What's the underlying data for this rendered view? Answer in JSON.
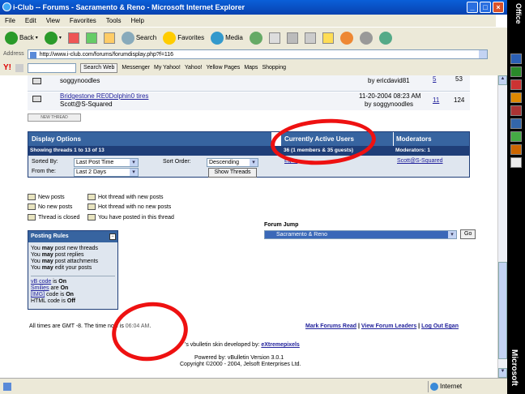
{
  "window": {
    "title": "i-Club -- Forums - Sacramento & Reno - Microsoft Internet Explorer"
  },
  "menu": [
    "File",
    "Edit",
    "View",
    "Favorites",
    "Tools",
    "Help"
  ],
  "toolbar": {
    "back": "Back",
    "search": "Search",
    "favorites": "Favorites",
    "media": "Media"
  },
  "address": {
    "label": "Address",
    "url": "http://www.i-club.com/forums/forumdisplay.php?f=116"
  },
  "yahoo": {
    "logo": "Y!",
    "search_btn": "Search Web",
    "items": [
      "Messenger",
      "My Yahoo!",
      "Yahoo!",
      "Yellow Pages",
      "Maps",
      "Shopping"
    ]
  },
  "threads": [
    {
      "title": "",
      "author": "soggynoodles",
      "date": "",
      "last_by": "by ericdavid81",
      "replies": "5",
      "views": "53"
    },
    {
      "title": "Bridgestone RE0Dolphin0 tires",
      "author": "Scott@S-Squared",
      "date": "11-20-2004 08:23 AM",
      "last_by": "by soggynoodles",
      "replies": "11",
      "views": "124"
    }
  ],
  "new_thread_btn": "NEW THREAD",
  "display": {
    "header": "Display Options",
    "sub": "Showing threads 1 to 13 of 13",
    "sorted_by_label": "Sorted By:",
    "sorted_by": "Last Post Time",
    "from_label": "From the:",
    "from": "Last 2 Days",
    "sort_order_label": "Sort Order:",
    "sort_order": "Descending",
    "show_btn": "Show Threads"
  },
  "active_users": {
    "header": "Currently Active Users",
    "sub": "36 (1 members & 35 guests)",
    "user": "Egan"
  },
  "moderators": {
    "header": "Moderators",
    "sub": "Moderators: 1",
    "name": "Scott@S-Squared"
  },
  "legend": [
    {
      "label": "New posts"
    },
    {
      "label": "Hot thread with new posts"
    },
    {
      "label": "No new posts"
    },
    {
      "label": "Hot thread with no new posts"
    },
    {
      "label": "Thread is closed"
    },
    {
      "label": "You have posted in this thread"
    }
  ],
  "forum_jump": {
    "label": "Forum Jump",
    "value": "Sacramento & Reno",
    "go": "Go"
  },
  "posting_rules": {
    "header": "Posting Rules",
    "lines": [
      {
        "a": "You ",
        "b": "may",
        "c": " post new threads"
      },
      {
        "a": "You ",
        "b": "may",
        "c": " post replies"
      },
      {
        "a": "You ",
        "b": "may",
        "c": " post attachments"
      },
      {
        "a": "You ",
        "b": "may",
        "c": " edit your posts"
      }
    ],
    "codes": [
      {
        "name": "vB code",
        "rest": " is ",
        "state": "On"
      },
      {
        "name": "Smilies",
        "rest": " are ",
        "state": "On"
      },
      {
        "name": "[IMG]",
        "rest": " code is ",
        "state": "On"
      },
      {
        "name": "HTML code",
        "rest": " is ",
        "state": "Off"
      }
    ]
  },
  "footer": {
    "time_a": "All times are GMT -8. The time now is ",
    "time_b": "06:04 AM",
    "time_c": ".",
    "links": [
      "Mark Forums Read",
      "View Forum Leaders",
      "Log Out Egan"
    ],
    "skin_a": "'s vbulletin skin developed by: ",
    "skin_b": "eXtremepixels",
    "powered": "Powered by: vBulletin Version 3.0.1",
    "copyright": "Copyright ©2000 - 2004, Jelsoft Enterprises Ltd."
  },
  "status": {
    "zone": "Internet"
  },
  "office": {
    "top": "Office",
    "bottom": "Microsoft"
  },
  "colors": {
    "header_blue": "#3764a0",
    "sub_dark": "#1f3e78",
    "annotation": "#ee1111"
  }
}
